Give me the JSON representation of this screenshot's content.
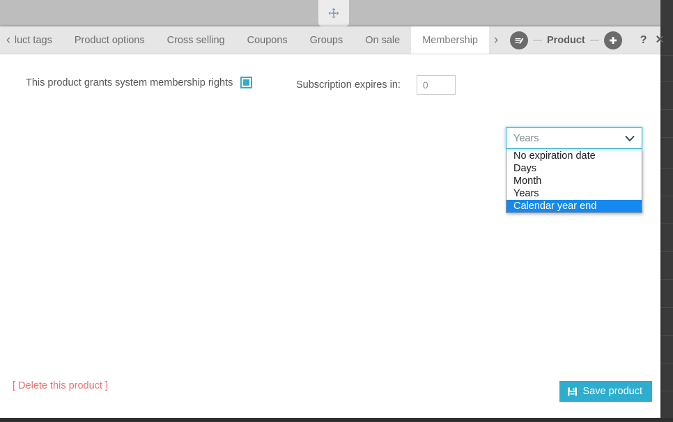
{
  "window": {
    "drag_handle_icon": "move-arrows-icon",
    "title": "Product",
    "edit_icon": "edit-pencil-circle-icon",
    "add_icon": "plus-circle-icon",
    "help_label": "?",
    "close_label": "✕"
  },
  "tabbar": {
    "prev_arrow": "‹",
    "next_arrow": "›",
    "tabs": [
      {
        "label": "duct tags",
        "active": false
      },
      {
        "label": "Product options",
        "active": false
      },
      {
        "label": "Cross selling",
        "active": false
      },
      {
        "label": "Coupons",
        "active": false
      },
      {
        "label": "Groups",
        "active": false
      },
      {
        "label": "On sale",
        "active": false
      },
      {
        "label": "Membership",
        "active": true
      }
    ]
  },
  "form": {
    "grants_label": "This product grants system membership rights",
    "grants_checked": true,
    "expires_label": "Subscription expires in:",
    "expires_value": "0",
    "expires_placeholder": "0",
    "period": {
      "selected": "Years",
      "options": [
        "No expiration date",
        "Days",
        "Month",
        "Years",
        "Calendar year end"
      ],
      "highlighted": "Calendar year end"
    }
  },
  "footer": {
    "delete_label": "[ Delete this product ]",
    "save_label": "Save product",
    "save_icon": "floppy-save-icon"
  },
  "colors": {
    "accent": "#2eadcf",
    "highlight": "#1589f0",
    "danger": "#ef6f6c",
    "chrome": "#e6e6e6",
    "backdrop": "#bdbdbd"
  }
}
